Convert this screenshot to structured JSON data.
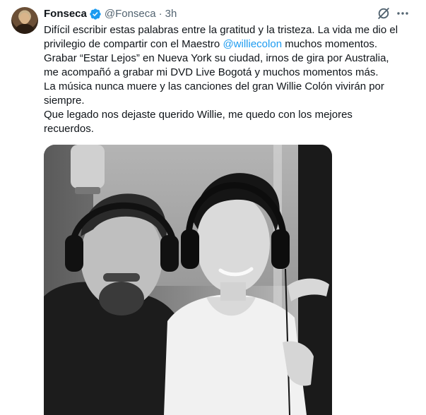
{
  "tweet": {
    "author": {
      "display_name": "Fonseca",
      "handle": "@Fonseca",
      "verified": true
    },
    "separator": "·",
    "time": "3h",
    "icons": {
      "grok": "grok-icon",
      "more": "more-icon",
      "verified": "verified-badge-icon"
    },
    "text_lines": [
      "Difícil escribir estas palabras entre la gratitud y la tristeza. La vida me dio el",
      "privilegio de compartir con el Maestro ",
      "Grabar “Estar Lejos” en Nueva York su ciudad, irnos de gira por Australia,",
      "me acompañó a grabar mi DVD Live Bogotá y muchos momentos más.",
      "La música nunca muere y las canciones del gran Willie Colón  vivirán por",
      "siempre.",
      "Que legado nos dejaste querido Willie, me quedo con los mejores",
      "recuerdos."
    ],
    "mention": "@williecolon",
    "mention_suffix": " muchos momentos.",
    "colors": {
      "text": "#0f1419",
      "secondary": "#536471",
      "accent": "#1d9bf0"
    }
  }
}
